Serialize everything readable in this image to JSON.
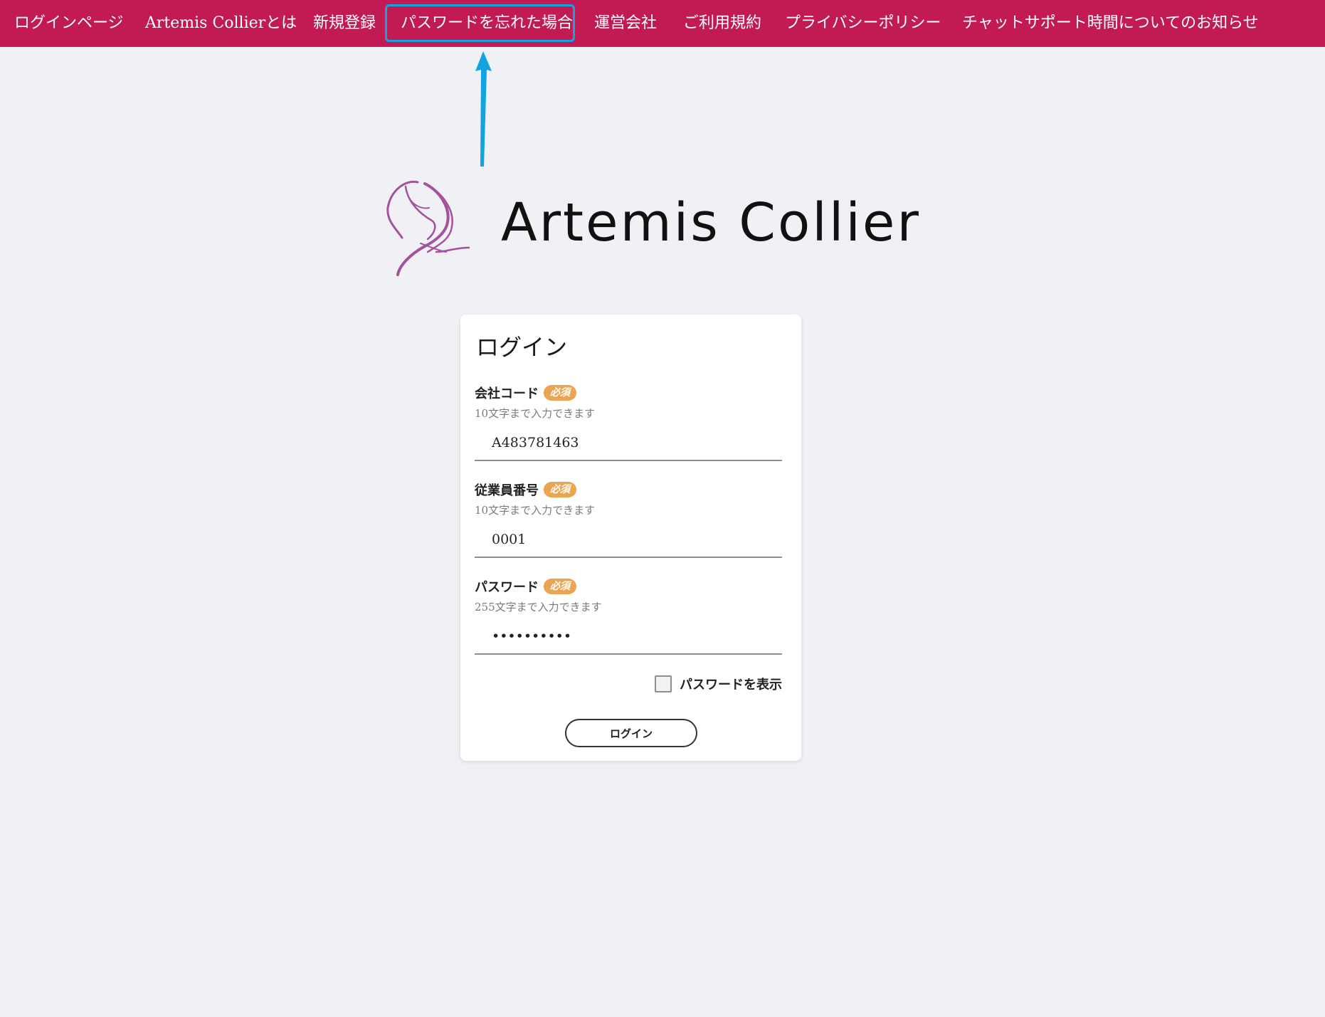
{
  "nav": {
    "items": [
      {
        "label": "ログインページ"
      },
      {
        "label": "Artemis Collierとは"
      },
      {
        "label": "新規登録"
      },
      {
        "label": "パスワードを忘れた場合"
      },
      {
        "label": "運営会社"
      },
      {
        "label": "ご利用規約"
      },
      {
        "label": "プライバシーポリシー"
      },
      {
        "label": "チャットサポート時間についてのお知らせ"
      }
    ],
    "highlighted_item": "パスワードを忘れた場合",
    "background_color": "#c21a55",
    "highlight_color": "#12a3e0"
  },
  "brand": {
    "name": "Artemis Collier",
    "logo_icon": "woman-silhouette-logo",
    "logo_color": "#a4519f"
  },
  "login_form": {
    "title": "ログイン",
    "required_label": "必須",
    "fields": [
      {
        "label": "会社コード",
        "hint": "10文字まで入力できます",
        "value": "A483781463",
        "type": "text"
      },
      {
        "label": "従業員番号",
        "hint": "10文字まで入力できます",
        "value": "0001",
        "type": "text"
      },
      {
        "label": "パスワード",
        "hint": "255文字まで入力できます",
        "value": "••••••••••",
        "type": "password"
      }
    ],
    "show_password_label": "パスワードを表示",
    "show_password_checked": false,
    "submit_label": "ログイン",
    "badge_color": "#e9a551"
  }
}
